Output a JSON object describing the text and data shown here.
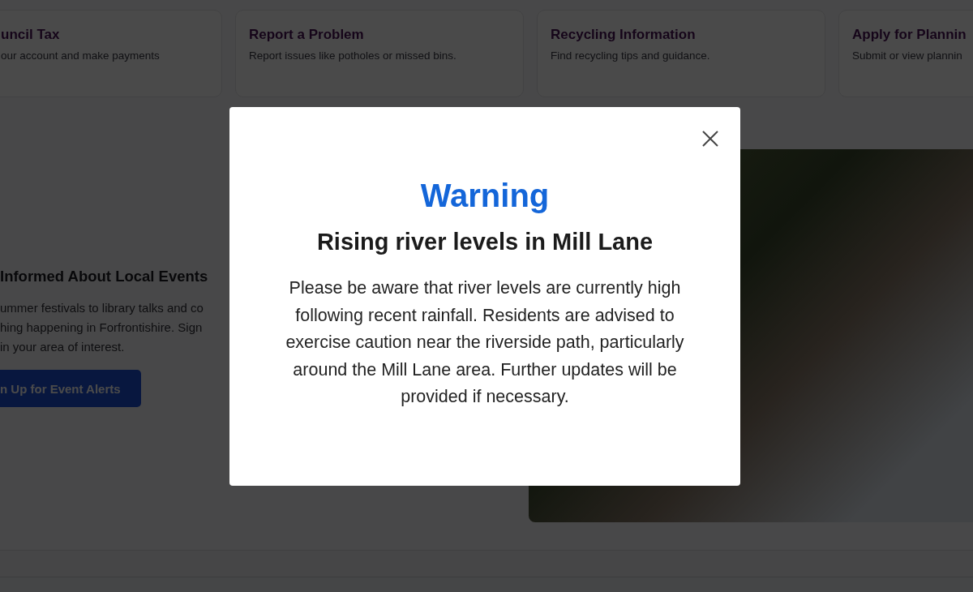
{
  "service_cards": [
    {
      "title": "uncil Tax",
      "description": "our account and make payments"
    },
    {
      "title": "Report a Problem",
      "description": "Report issues like potholes or missed bins."
    },
    {
      "title": "Recycling Information",
      "description": "Find recycling tips and guidance."
    },
    {
      "title": "Apply for Plannin",
      "description": "Submit or view plannin"
    }
  ],
  "events": {
    "title": "Informed About Local Events",
    "lines": [
      "ummer festivals to library talks and co",
      "hing happening in Forfrontishire. Sign",
      "in your area of interest."
    ],
    "button": "n Up for Event Alerts"
  },
  "modal": {
    "heading": "Warning",
    "title": "Rising river levels in Mill Lane",
    "message": "Please be aware that river levels are currently high following recent rainfall. Residents are advised to exercise caution near the riverside path, particularly around the Mill Lane area. Further updates will be provided if necessary."
  }
}
